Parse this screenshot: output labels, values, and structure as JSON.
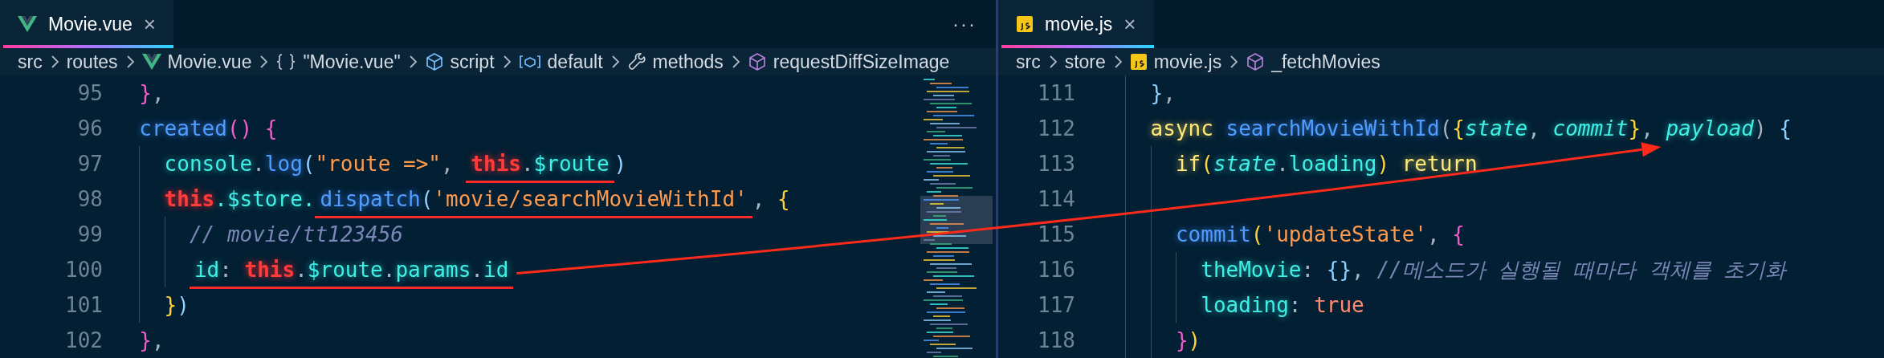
{
  "editor_groups": [
    {
      "tabs": [
        {
          "label": "Movie.vue",
          "kind": "vue",
          "selected": true,
          "close": "×"
        }
      ],
      "more_actions": "···",
      "breadcrumbs": [
        {
          "label": "src"
        },
        {
          "label": "routes"
        },
        {
          "label": "Movie.vue",
          "kind": "vue"
        },
        {
          "label": "\"Movie.vue\"",
          "kind": "braces"
        },
        {
          "label": "script",
          "kind": "cube"
        },
        {
          "label": "default",
          "kind": "field"
        },
        {
          "label": "methods",
          "kind": "wrench"
        },
        {
          "label": "requestDiffSizeImage",
          "kind": "method"
        }
      ],
      "lines": [
        {
          "number": "95",
          "tokens": [
            {
              "kind": "pink",
              "text": "  }"
            },
            {
              "kind": "punct",
              "text": ","
            }
          ]
        },
        {
          "number": "96",
          "tokens": [
            {
              "kind": "fn",
              "text": "  created"
            },
            {
              "kind": "pink",
              "text": "() {"
            }
          ]
        },
        {
          "number": "97",
          "tokens": [
            {
              "kind": "prop",
              "text": "    console"
            },
            {
              "kind": "punct",
              "text": "."
            },
            {
              "kind": "fn",
              "text": "log"
            },
            {
              "kind": "lblue",
              "text": "("
            },
            {
              "kind": "str",
              "text": "\"route =>\""
            },
            {
              "kind": "punct",
              "text": ", "
            },
            {
              "kind": "underline",
              "tokens": [
                {
                  "kind": "this",
                  "text": "this"
                },
                {
                  "kind": "punct",
                  "text": "."
                },
                {
                  "kind": "prop",
                  "text": "$route"
                }
              ]
            },
            {
              "kind": "lblue",
              "text": ")"
            }
          ]
        },
        {
          "number": "98",
          "tokens": [
            {
              "kind": "this",
              "text": "    this"
            },
            {
              "kind": "prop",
              "text": ".$store."
            },
            {
              "kind": "underline",
              "tokens": [
                {
                  "kind": "fn",
                  "text": "dispatch"
                },
                {
                  "kind": "lblue",
                  "text": "("
                },
                {
                  "kind": "str",
                  "text": "'movie/searchMovieWithId'"
                }
              ]
            },
            {
              "kind": "punct",
              "text": ", "
            },
            {
              "kind": "yellow",
              "text": "{"
            }
          ]
        },
        {
          "number": "99",
          "tokens": [
            {
              "kind": "comment",
              "text": "      // movie/tt123456"
            }
          ]
        },
        {
          "number": "100",
          "tokens": [
            {
              "kind": "underline",
              "tokens": [
                {
                  "kind": "prop",
                  "text": "      id"
                },
                {
                  "kind": "punct",
                  "text": ": "
                },
                {
                  "kind": "this",
                  "text": "this"
                },
                {
                  "kind": "punct",
                  "text": "."
                },
                {
                  "kind": "prop",
                  "text": "$route"
                },
                {
                  "kind": "punct",
                  "text": "."
                },
                {
                  "kind": "prop",
                  "text": "params"
                },
                {
                  "kind": "punct",
                  "text": "."
                },
                {
                  "kind": "prop",
                  "text": "id"
                }
              ]
            }
          ]
        },
        {
          "number": "101",
          "tokens": [
            {
              "kind": "yellow",
              "text": "    }"
            },
            {
              "kind": "lblue",
              "text": ")"
            }
          ]
        },
        {
          "number": "102",
          "tokens": [
            {
              "kind": "pink",
              "text": "  }"
            },
            {
              "kind": "punct",
              "text": ","
            }
          ]
        }
      ]
    },
    {
      "tabs": [
        {
          "label": "movie.js",
          "kind": "js",
          "selected": true,
          "close": "×"
        }
      ],
      "breadcrumbs": [
        {
          "label": "src"
        },
        {
          "label": "store"
        },
        {
          "label": "movie.js",
          "kind": "js"
        },
        {
          "label": "_fetchMovies",
          "kind": "method"
        }
      ],
      "lines": [
        {
          "number": "111",
          "tokens": [
            {
              "kind": "lblue",
              "text": "    }"
            },
            {
              "kind": "punct",
              "text": ","
            }
          ]
        },
        {
          "number": "112",
          "tokens": [
            {
              "kind": "kw",
              "text": "    async"
            },
            {
              "kind": "fn",
              "text": " searchMovieWithId"
            },
            {
              "kind": "punct",
              "text": "("
            },
            {
              "kind": "yellow",
              "text": "{"
            },
            {
              "kind": "param",
              "text": "state"
            },
            {
              "kind": "punct",
              "text": ", "
            },
            {
              "kind": "param",
              "text": "commit"
            },
            {
              "kind": "yellow",
              "text": "}"
            },
            {
              "kind": "punct",
              "text": ", "
            },
            {
              "kind": "param",
              "text": "payload"
            },
            {
              "kind": "punct",
              "text": ") "
            },
            {
              "kind": "lblue",
              "text": "{"
            }
          ]
        },
        {
          "number": "113",
          "tokens": [
            {
              "kind": "kw",
              "text": "      if"
            },
            {
              "kind": "yellow",
              "text": "("
            },
            {
              "kind": "param",
              "text": "state"
            },
            {
              "kind": "punct",
              "text": "."
            },
            {
              "kind": "prop",
              "text": "loading"
            },
            {
              "kind": "yellow",
              "text": ")"
            },
            {
              "kind": "kw",
              "text": " return"
            }
          ]
        },
        {
          "number": "114"
        },
        {
          "number": "115",
          "tokens": [
            {
              "kind": "fn",
              "text": "      commit"
            },
            {
              "kind": "yellow",
              "text": "("
            },
            {
              "kind": "str",
              "text": "'updateState'"
            },
            {
              "kind": "punct",
              "text": ", "
            },
            {
              "kind": "pink",
              "text": "{"
            }
          ]
        },
        {
          "number": "116",
          "tokens": [
            {
              "kind": "prop",
              "text": "        theMovie"
            },
            {
              "kind": "punct",
              "text": ": "
            },
            {
              "kind": "lblue",
              "text": "{}"
            },
            {
              "kind": "punct",
              "text": ", "
            },
            {
              "kind": "comment",
              "text": "//메소드가 실행될 때마다 객체를 초기화"
            }
          ]
        },
        {
          "number": "117",
          "tokens": [
            {
              "kind": "prop",
              "text": "        loading"
            },
            {
              "kind": "punct",
              "text": ": "
            },
            {
              "kind": "bool",
              "text": "true"
            }
          ]
        },
        {
          "number": "118",
          "tokens": [
            {
              "kind": "pink",
              "text": "      }"
            },
            {
              "kind": "yellow",
              "text": ")"
            }
          ]
        }
      ]
    }
  ],
  "annotations": [
    {
      "kind": "arrow"
    }
  ]
}
